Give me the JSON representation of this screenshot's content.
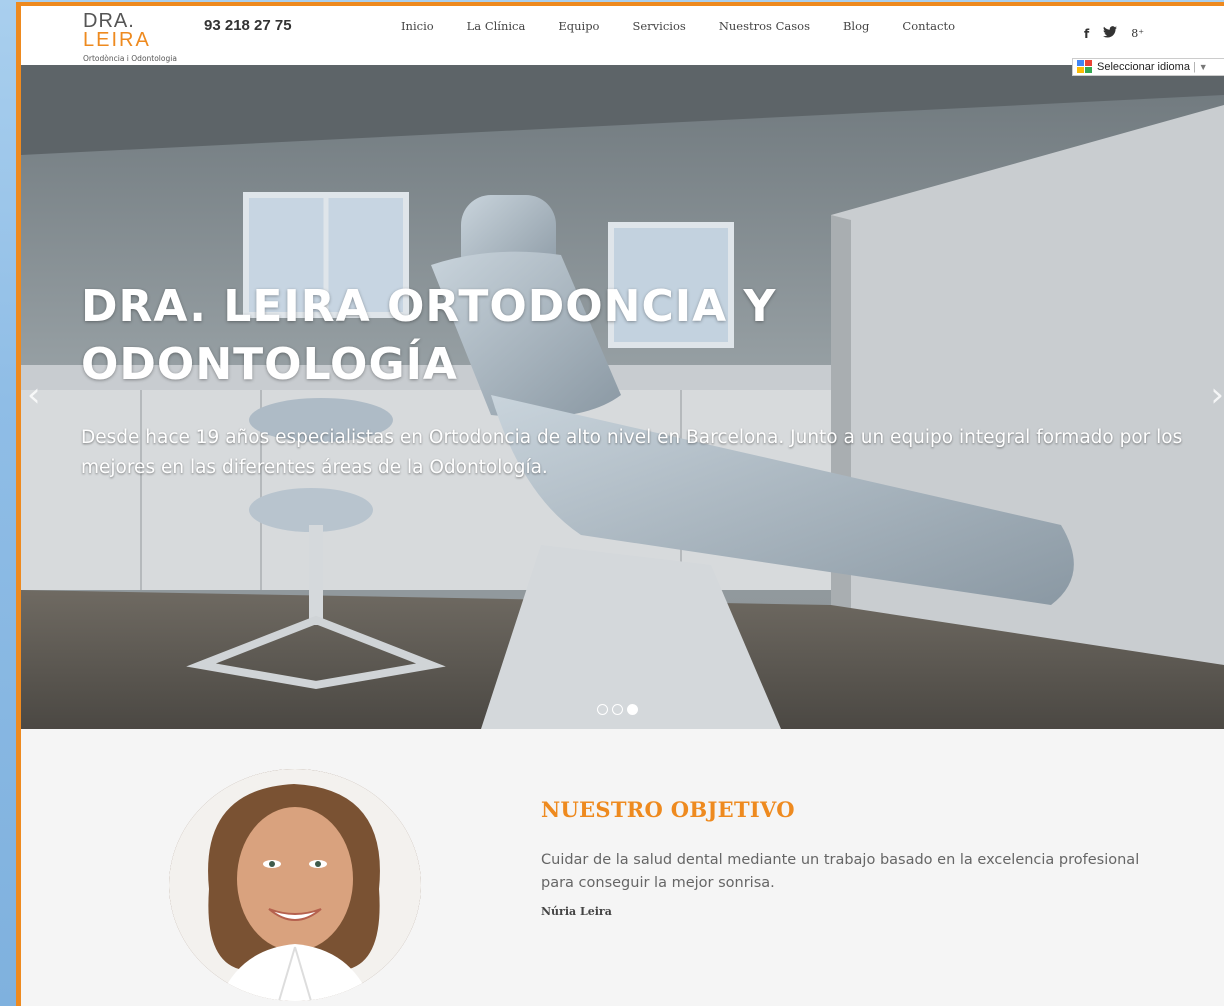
{
  "header": {
    "logo_top": "DRA.",
    "logo_main": "LEIRA",
    "logo_sub": "Ortodòncia i Odontologia",
    "phone": "93 218 27 75",
    "nav": [
      "Inicio",
      "La Clínica",
      "Equipo",
      "Servicios",
      "Nuestros Casos",
      "Blog",
      "Contacto"
    ],
    "social": {
      "facebook": "f",
      "twitter": "twitter-icon",
      "googleplus": "8⁺"
    },
    "translate_label": "Seleccionar idioma",
    "translate_sep": "|",
    "translate_arrow": "▼"
  },
  "hero": {
    "title": "DRA. LEIRA ORTODONCIA Y ODONTOLOGÍA",
    "text": "Desde hace 19 años especialistas en Ortodoncia de alto nivel en Barcelona. Junto a un equipo integral formado por los mejores en las diferentes áreas de la Odontología.",
    "prev_arrow": "‹",
    "next_arrow": "›",
    "slides": 3,
    "active_slide": 3
  },
  "objective": {
    "title": "NUESTRO OBJETIVO",
    "text": "Cuidar de la salud dental mediante un trabajo basado en la excelencia profesional para conseguir la mejor sonrisa.",
    "signature": "Núria Leira"
  },
  "colors": {
    "accent": "#ee8a1f",
    "page_bg": "#f5f5f5"
  }
}
